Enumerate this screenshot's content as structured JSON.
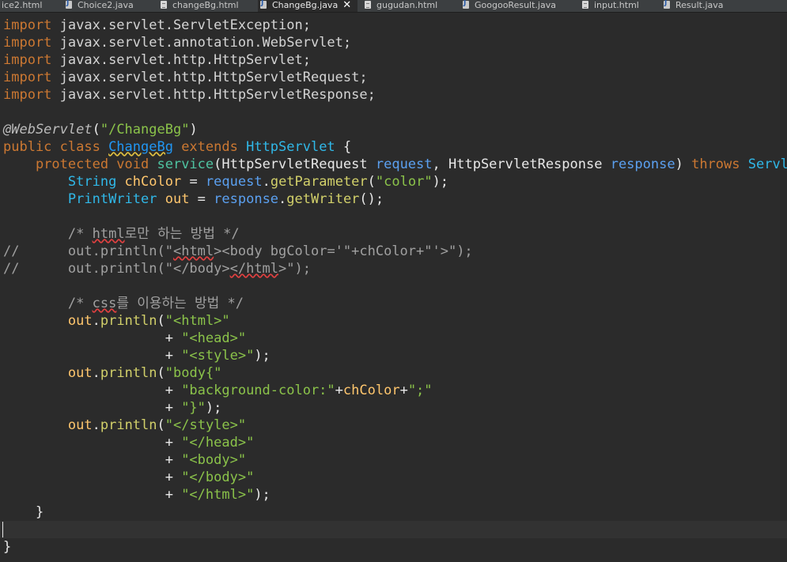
{
  "tabs": [
    {
      "label": "ice2.html",
      "icon": "none"
    },
    {
      "label": "Choice2.java",
      "icon": "java-file-icon"
    },
    {
      "label": "changeBg.html",
      "icon": "html-file-icon"
    },
    {
      "label": "ChangeBg.java",
      "icon": "java-file-icon",
      "active": true
    },
    {
      "label": "gugudan.html",
      "icon": "html-file-icon"
    },
    {
      "label": "GoogooResult.java",
      "icon": "java-file-icon"
    },
    {
      "label": "input.html",
      "icon": "html-file-icon"
    },
    {
      "label": "Result.java",
      "icon": "java-file-icon"
    }
  ],
  "close_glyph": "✕",
  "code": {
    "l1": {
      "kw": "import",
      "rest": " javax.servlet.ServletException;"
    },
    "l2": {
      "kw": "import",
      "rest": " javax.servlet.annotation.WebServlet;"
    },
    "l3": {
      "kw": "import",
      "rest": " javax.servlet.http.HttpServlet;"
    },
    "l4": {
      "kw": "import",
      "rest": " javax.servlet.http.HttpServletRequest;"
    },
    "l5": {
      "kw": "import",
      "rest": " javax.servlet.http.HttpServletResponse;"
    },
    "l7": {
      "ann": "@WebServlet",
      "p1": "(",
      "str": "\"/ChangeBg\"",
      "p2": ")"
    },
    "l8": {
      "kw1": "public class ",
      "cls": "ChangeBg",
      "kw2": " extends ",
      "type": "HttpServlet",
      "rest": " {"
    },
    "l9": {
      "indent": "    ",
      "kw1": "protected void ",
      "name": "service",
      "p1": "(",
      "t1": "HttpServletRequest",
      "param1": " request",
      "c": ", ",
      "t2": "HttpServletResponse",
      "param2": " response",
      "p2": ") ",
      "kw2": "throws ",
      "t3": "ServletE"
    },
    "l10": {
      "indent": "        ",
      "type": "String",
      "var": " chColor",
      "eq": " = ",
      "obj": "request",
      "dot": ".",
      "meth": "getParameter",
      "p1": "(",
      "str": "\"color\"",
      "p2": ");"
    },
    "l11": {
      "indent": "        ",
      "type": "PrintWriter",
      "var": " out",
      "eq": " = ",
      "obj": "response",
      "dot": ".",
      "meth": "getWriter",
      "p2": "();"
    },
    "l13": {
      "indent": "        ",
      "c1": "/* ",
      "word": "html",
      "c2": "로만 하는 방법 */"
    },
    "l14": {
      "slashes": "//",
      "indent": "      ",
      "t1": "out.println(\"",
      "word": "<html",
      "t2": "><body bgColor='\"+chColor+\"'>\");"
    },
    "l15": {
      "slashes": "//",
      "indent": "      ",
      "t1": "out.println(\"</body>",
      "word": "</html",
      "t2": ">\");"
    },
    "l17": {
      "indent": "        ",
      "c1": "/* ",
      "word": "css",
      "c2": "를 이용하는 방법 */"
    },
    "l18": {
      "indent": "        ",
      "var": "out",
      "dot": ".",
      "meth": "println",
      "p1": "(",
      "str": "\"<html>\""
    },
    "l19": {
      "indent": "                    ",
      "plus": "+ ",
      "str": "\"<head>\""
    },
    "l20": {
      "indent": "                    ",
      "plus": "+ ",
      "str": "\"<style>\"",
      "end": ");"
    },
    "l21": {
      "indent": "        ",
      "var": "out",
      "dot": ".",
      "meth": "println",
      "p1": "(",
      "str": "\"body{\""
    },
    "l22": {
      "indent": "                    ",
      "plus": "+ ",
      "str": "\"background-color:\"",
      "plus2": "+",
      "var": "chColor",
      "plus3": "+",
      "str2": "\";\""
    },
    "l23": {
      "indent": "                    ",
      "plus": "+ ",
      "str": "\"}\"",
      "end": ");"
    },
    "l24": {
      "indent": "        ",
      "var": "out",
      "dot": ".",
      "meth": "println",
      "p1": "(",
      "str": "\"</style>\""
    },
    "l25": {
      "indent": "                    ",
      "plus": "+ ",
      "str": "\"</head>\""
    },
    "l26": {
      "indent": "                    ",
      "plus": "+ ",
      "str": "\"<body>\""
    },
    "l27": {
      "indent": "                    ",
      "plus": "+ ",
      "str": "\"</body>\""
    },
    "l28": {
      "indent": "                    ",
      "plus": "+ ",
      "str": "\"</html>\"",
      "end": ");"
    },
    "l29": {
      "indent": "    ",
      "brace": "}"
    },
    "l31": {
      "brace": "}"
    }
  }
}
